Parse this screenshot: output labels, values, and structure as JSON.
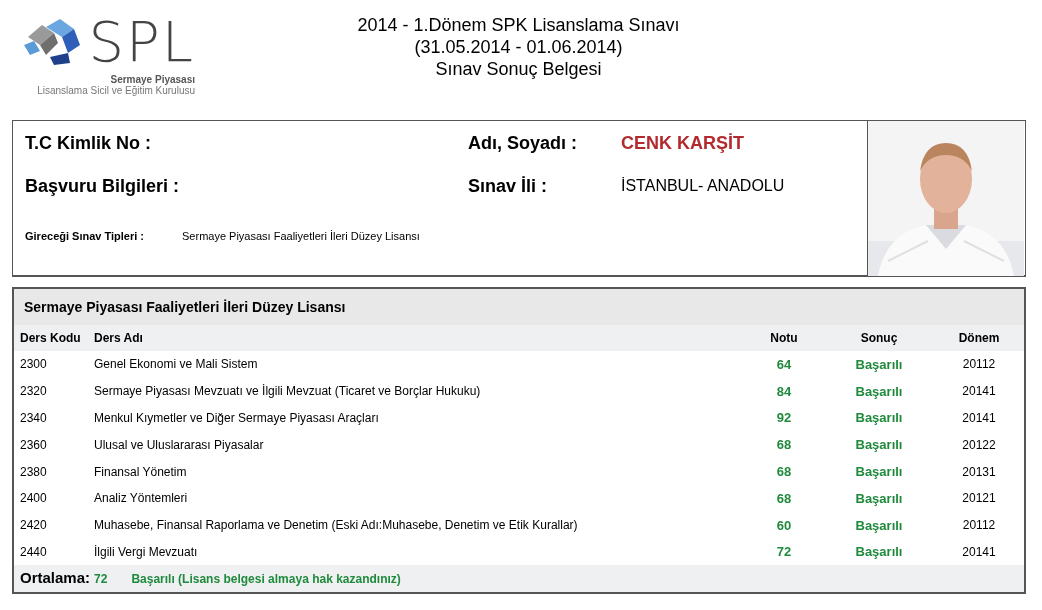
{
  "logo": {
    "mark": "SPL",
    "line_1": "Sermaye Piyasası",
    "line_2": "Lisanslama Sicil ve Eğitim Kurulusu"
  },
  "title": [
    "2014 - 1.Dönem SPK Lisanslama Sınavı",
    "(31.05.2014 - 01.06.2014)",
    "Sınav Sonuç Belgesi"
  ],
  "info": {
    "id_label": "T.C Kimlik No :",
    "name_label": "Adı, Soyadı :",
    "name_value": "CENK KARŞİT",
    "application_label": "Başvuru Bilgileri :",
    "city_label": "Sınav İli :",
    "city_value": "İSTANBUL- ANADOLU",
    "types_label": "Gireceği Sınav Tipleri :",
    "types_value": "Sermaye Piyasası Faaliyetleri İleri Düzey Lisansı"
  },
  "results": {
    "title": "Sermaye Piyasası Faaliyetleri İleri Düzey Lisansı",
    "columns": [
      "Ders Kodu",
      "Ders Adı",
      "Notu",
      "Sonuç",
      "Dönem"
    ],
    "rows": [
      {
        "code": "2300",
        "name": "Genel Ekonomi ve Mali Sistem",
        "grade": "64",
        "result": "Başarılı",
        "term": "20112"
      },
      {
        "code": "2320",
        "name": "Sermaye Piyasası Mevzuatı ve İlgili Mevzuat (Ticaret ve Borçlar Hukuku)",
        "grade": "84",
        "result": "Başarılı",
        "term": "20141"
      },
      {
        "code": "2340",
        "name": "Menkul Kıymetler ve Diğer Sermaye Piyasası Araçları",
        "grade": "92",
        "result": "Başarılı",
        "term": "20141"
      },
      {
        "code": "2360",
        "name": "Ulusal ve Uluslararası Piyasalar",
        "grade": "68",
        "result": "Başarılı",
        "term": "20122"
      },
      {
        "code": "2380",
        "name": "Finansal Yönetim",
        "grade": "68",
        "result": "Başarılı",
        "term": "20131"
      },
      {
        "code": "2400",
        "name": "Analiz Yöntemleri",
        "grade": "68",
        "result": "Başarılı",
        "term": "20121"
      },
      {
        "code": "2420",
        "name": "Muhasebe, Finansal Raporlama ve Denetim (Eski Adı:Muhasebe, Denetim ve Etik Kurallar)",
        "grade": "60",
        "result": "Başarılı",
        "term": "20112"
      },
      {
        "code": "2440",
        "name": "İlgili Vergi Mevzuatı",
        "grade": "72",
        "result": "Başarılı",
        "term": "20141"
      }
    ],
    "average_label": "Ortalama:",
    "average_value": "72",
    "average_result": "Başarılı (Lisans belgesi almaya hak kazandınız)"
  }
}
